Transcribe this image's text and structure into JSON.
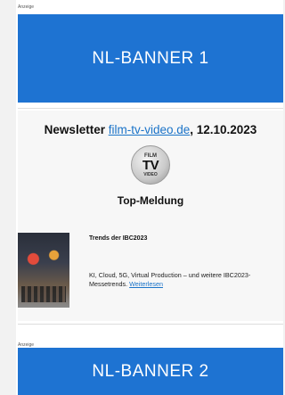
{
  "ad_label_1": "Anzeige",
  "banner_1": "NL-BANNER 1",
  "newsletter": {
    "prefix": "Newsletter ",
    "link": "film-tv-video.de",
    "date": ", 12.10.2023"
  },
  "logo": {
    "line1": "FILM",
    "line2": "TV",
    "line3": "VIDEO"
  },
  "section_title": "Top-Meldung",
  "article": {
    "title": "Trends der IBC2023",
    "text": "KI, Cloud, 5G, Virtual Production – und weitere IBC2023-Messetrends. ",
    "link": "Weiterlesen"
  },
  "ad_label_2": "Anzeige",
  "banner_2": "NL-BANNER 2",
  "colors": {
    "banner": "#1e73d2",
    "link": "#1a73c8"
  }
}
